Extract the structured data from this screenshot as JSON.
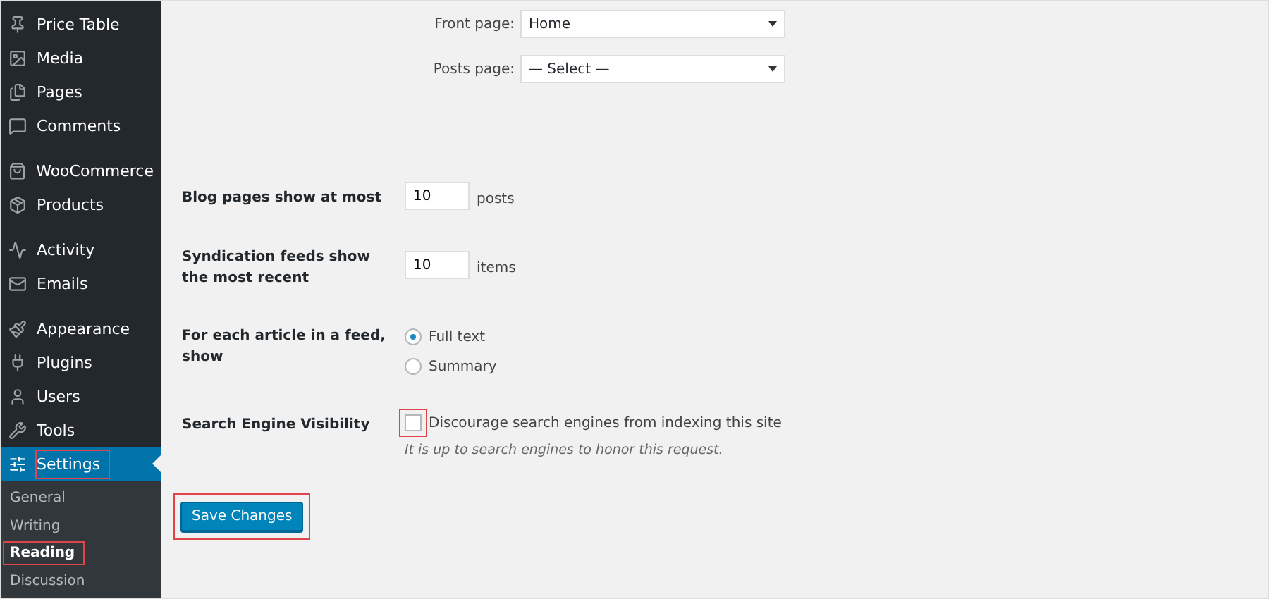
{
  "sidebar": {
    "groups": [
      {
        "items": [
          {
            "label": "Price Table",
            "current": false,
            "highlighted": false
          },
          {
            "label": "Media",
            "current": false,
            "highlighted": false
          },
          {
            "label": "Pages",
            "current": false,
            "highlighted": false
          },
          {
            "label": "Comments",
            "current": false,
            "highlighted": false
          }
        ]
      },
      {
        "items": [
          {
            "label": "WooCommerce",
            "current": false,
            "highlighted": false
          },
          {
            "label": "Products",
            "current": false,
            "highlighted": false
          }
        ]
      },
      {
        "items": [
          {
            "label": "Activity",
            "current": false,
            "highlighted": false
          },
          {
            "label": "Emails",
            "current": false,
            "highlighted": false
          }
        ]
      },
      {
        "items": [
          {
            "label": "Appearance",
            "current": false,
            "highlighted": false
          },
          {
            "label": "Plugins",
            "current": false,
            "highlighted": false
          },
          {
            "label": "Users",
            "current": false,
            "highlighted": false
          },
          {
            "label": "Tools",
            "current": false,
            "highlighted": false
          },
          {
            "label": "Settings",
            "current": true,
            "highlighted": true
          }
        ]
      }
    ],
    "submenu": [
      {
        "label": "General",
        "selected": false,
        "highlighted": false
      },
      {
        "label": "Writing",
        "selected": false,
        "highlighted": false
      },
      {
        "label": "Reading",
        "selected": true,
        "highlighted": true
      },
      {
        "label": "Discussion",
        "selected": false,
        "highlighted": false
      }
    ]
  },
  "static_page": {
    "selects": [
      {
        "label": "Front page:",
        "value": "Home"
      },
      {
        "label": "Posts page:",
        "value": "— Select —"
      }
    ]
  },
  "settings": [
    {
      "kind": "number",
      "label": "Blog pages show at most",
      "value": "10",
      "unit": "posts"
    },
    {
      "kind": "number",
      "label": "Syndication feeds show the most recent",
      "value": "10",
      "unit": "items"
    },
    {
      "kind": "radio",
      "label": "For each article in a feed, show",
      "options": [
        {
          "label": "Full text",
          "selected": true
        },
        {
          "label": "Summary",
          "selected": false
        }
      ]
    },
    {
      "kind": "checkbox",
      "label": "Search Engine Visibility",
      "option": "Discourage search engines from indexing this site",
      "checked": false,
      "highlighted": true,
      "description": "It is up to search engines to honor this request."
    }
  ],
  "save_button": {
    "label": "Save Changes",
    "highlighted": true
  }
}
